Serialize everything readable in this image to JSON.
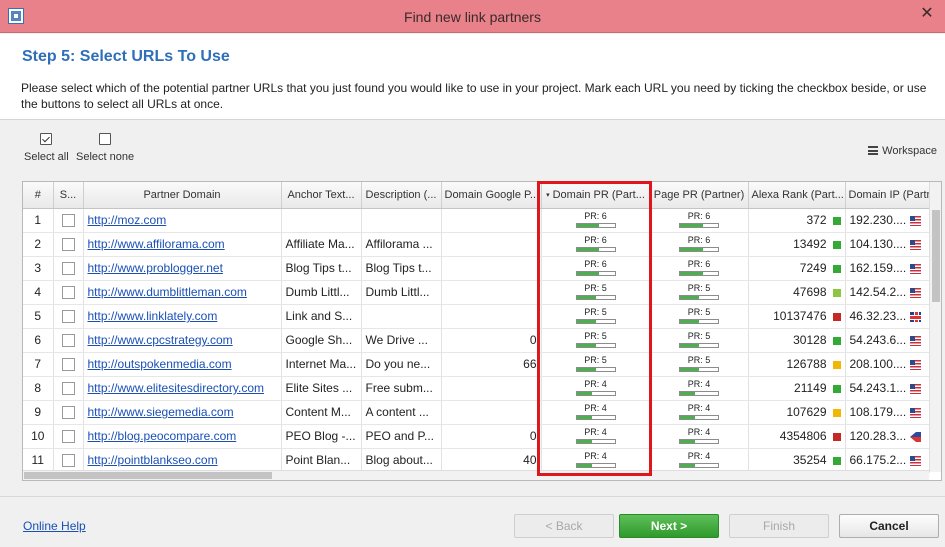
{
  "window": {
    "title": "Find new link partners",
    "close_glyph": "✕"
  },
  "header": {
    "step_title": "Step 5: Select URLs To Use",
    "instructions": "Please select which of the potential partner URLs that you just found you would like to use in your project. Mark each URL you need by ticking the checkbox beside, or use the buttons to select all URLs at once."
  },
  "toolbar": {
    "select_all": "Select all",
    "select_none": "Select none",
    "workspace": "Workspace"
  },
  "grid": {
    "columns": [
      "#",
      "S...",
      "Partner Domain",
      "Anchor Text...",
      "Description (...",
      "Domain Google P...",
      "Domain PR (Part...",
      "Page PR (Partner)",
      "Alexa Rank (Part...",
      "Domain IP (Partn"
    ],
    "sorted_column_arrow": "▾",
    "rows": [
      {
        "num": "1",
        "url": "http://moz.com",
        "anchor": "",
        "desc": "",
        "gp": "",
        "dpr": "PR: 6",
        "dpr_fill": 0.6,
        "ppr": "PR: 6",
        "ppr_fill": 0.6,
        "alexa": "372",
        "alexa_color": "#35a935",
        "ip": "192.230....",
        "flag": "us"
      },
      {
        "num": "2",
        "url": "http://www.affilorama.com",
        "anchor": "Affiliate Ma...",
        "desc": "Affilorama ...",
        "gp": "",
        "dpr": "PR: 6",
        "dpr_fill": 0.6,
        "ppr": "PR: 6",
        "ppr_fill": 0.6,
        "alexa": "13492",
        "alexa_color": "#35a935",
        "ip": "104.130....",
        "flag": "us"
      },
      {
        "num": "3",
        "url": "http://www.problogger.net",
        "anchor": "Blog Tips t...",
        "desc": "Blog Tips t...",
        "gp": "",
        "dpr": "PR: 6",
        "dpr_fill": 0.6,
        "ppr": "PR: 6",
        "ppr_fill": 0.6,
        "alexa": "7249",
        "alexa_color": "#35a935",
        "ip": "162.159....",
        "flag": "us"
      },
      {
        "num": "4",
        "url": "http://www.dumblittleman.com",
        "anchor": "Dumb Littl...",
        "desc": "Dumb Littl...",
        "gp": "",
        "dpr": "PR: 5",
        "dpr_fill": 0.5,
        "ppr": "PR: 5",
        "ppr_fill": 0.5,
        "alexa": "47698",
        "alexa_color": "#8cc63f",
        "ip": "142.54.2...",
        "flag": "us"
      },
      {
        "num": "5",
        "url": "http://www.linklately.com",
        "anchor": "Link and S...",
        "desc": "",
        "gp": "",
        "dpr": "PR: 5",
        "dpr_fill": 0.5,
        "ppr": "PR: 5",
        "ppr_fill": 0.5,
        "alexa": "10137476",
        "alexa_color": "#c62828",
        "ip": "46.32.23...",
        "flag": "uk"
      },
      {
        "num": "6",
        "url": "http://www.cpcstrategy.com",
        "anchor": "Google Sh...",
        "desc": "We Drive ...",
        "gp": "0",
        "dpr": "PR: 5",
        "dpr_fill": 0.5,
        "ppr": "PR: 5",
        "ppr_fill": 0.5,
        "alexa": "30128",
        "alexa_color": "#35a935",
        "ip": "54.243.6...",
        "flag": "us"
      },
      {
        "num": "7",
        "url": "http://outspokenmedia.com",
        "anchor": "Internet Ma...",
        "desc": "Do you ne...",
        "gp": "66",
        "dpr": "PR: 5",
        "dpr_fill": 0.5,
        "ppr": "PR: 5",
        "ppr_fill": 0.5,
        "alexa": "126788",
        "alexa_color": "#f2b705",
        "ip": "208.100....",
        "flag": "us"
      },
      {
        "num": "8",
        "url": "http://www.elitesitesdirectory.com",
        "anchor": "Elite Sites ...",
        "desc": "Free subm...",
        "gp": "",
        "dpr": "PR: 4",
        "dpr_fill": 0.4,
        "ppr": "PR: 4",
        "ppr_fill": 0.4,
        "alexa": "21149",
        "alexa_color": "#35a935",
        "ip": "54.243.1...",
        "flag": "us"
      },
      {
        "num": "9",
        "url": "http://www.siegemedia.com",
        "anchor": "Content M...",
        "desc": "A content ...",
        "gp": "",
        "dpr": "PR: 4",
        "dpr_fill": 0.4,
        "ppr": "PR: 4",
        "ppr_fill": 0.4,
        "alexa": "107629",
        "alexa_color": "#f2b705",
        "ip": "108.179....",
        "flag": "us"
      },
      {
        "num": "10",
        "url": "http://blog.peocompare.com",
        "anchor": "PEO Blog -...",
        "desc": "PEO and P...",
        "gp": "0",
        "dpr": "PR: 4",
        "dpr_fill": 0.4,
        "ppr": "PR: 4",
        "ppr_fill": 0.4,
        "alexa": "4354806",
        "alexa_color": "#c62828",
        "ip": "120.28.3...",
        "flag": "ph"
      },
      {
        "num": "11",
        "url": "http://pointblankseo.com",
        "anchor": "Point Blan...",
        "desc": "Blog about...",
        "gp": "40",
        "dpr": "PR: 4",
        "dpr_fill": 0.4,
        "ppr": "PR: 4",
        "ppr_fill": 0.4,
        "alexa": "35254",
        "alexa_color": "#35a935",
        "ip": "66.175.2...",
        "flag": "us"
      }
    ]
  },
  "footer": {
    "online_help": "Online Help",
    "back": "< Back",
    "next": "Next >",
    "finish": "Finish",
    "cancel": "Cancel"
  }
}
